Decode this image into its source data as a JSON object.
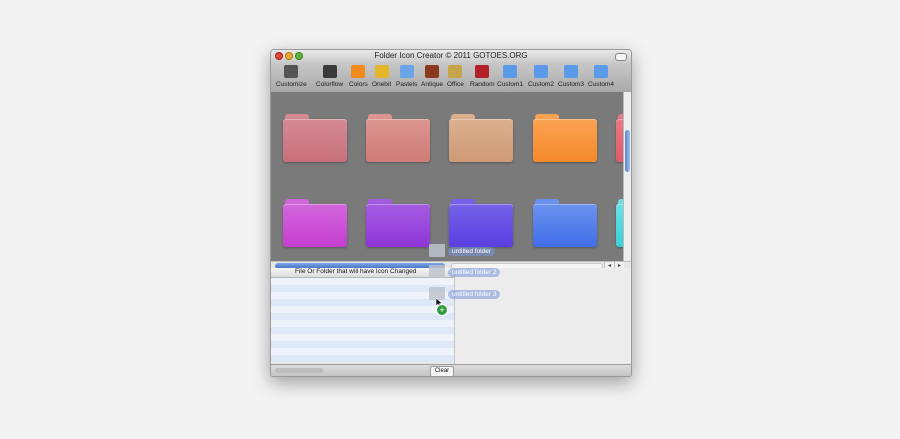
{
  "window": {
    "title": "Folder Icon Creator © 2011 GOTOES.ORG"
  },
  "toolbar": {
    "items": [
      {
        "label": "Customize",
        "icon": "tools-icon",
        "color": "#555555"
      },
      {
        "label": "Colorflow",
        "icon": "camera-icon",
        "color": "#3a3a3a"
      },
      {
        "label": "Colors",
        "icon": "folder-icon",
        "color": "#f08a1a"
      },
      {
        "label": "Onebit",
        "icon": "pencil-icon",
        "color": "#e5b52a"
      },
      {
        "label": "Pastels",
        "icon": "monitor-icon",
        "color": "#6aa5e8"
      },
      {
        "label": "Antique",
        "icon": "book-icon",
        "color": "#8a3a1f"
      },
      {
        "label": "Office",
        "icon": "notebook-icon",
        "color": "#c5a44a"
      },
      {
        "label": "Random",
        "icon": "red-book-icon",
        "color": "#b3202a"
      },
      {
        "label": "Custom1",
        "icon": "blue-folder-icon",
        "color": "#5b9ae8"
      },
      {
        "label": "Custom2",
        "icon": "blue-folder-icon",
        "color": "#5b9ae8"
      },
      {
        "label": "Custom3",
        "icon": "blue-folder-icon",
        "color": "#5b9ae8"
      },
      {
        "label": "Custom4",
        "icon": "blue-folder-icon",
        "color": "#5b9ae8"
      }
    ]
  },
  "folders": [
    {
      "color": "#c7707c",
      "tab": "#d58a94"
    },
    {
      "color": "#cf7b76",
      "tab": "#dc958f"
    },
    {
      "color": "#cf9a76",
      "tab": "#dbb08f"
    },
    {
      "color": "#f5892a",
      "tab": "#fba353"
    },
    {
      "color": "#e05a6a",
      "tab": "#e87a86"
    },
    {
      "color": "#c43ed0",
      "tab": "#d366dd"
    },
    {
      "color": "#8f35d6",
      "tab": "#a45ce2"
    },
    {
      "color": "#5a3ee0",
      "tab": "#7662ea"
    },
    {
      "color": "#3f6ee8",
      "tab": "#6c92ef"
    },
    {
      "color": "#3ad0d8",
      "tab": "#6be0e6"
    }
  ],
  "list": {
    "header": "File Or Folder that will have Icon Changed",
    "rows": 12
  },
  "drag": {
    "items": [
      "untitled folder",
      "untitled folder 2",
      "untitled folder 3"
    ],
    "badge": "+"
  },
  "bottom": {
    "clear_label": "Clear All"
  },
  "scroll": {
    "left_arrow": "◂",
    "right_arrow": "▸"
  }
}
